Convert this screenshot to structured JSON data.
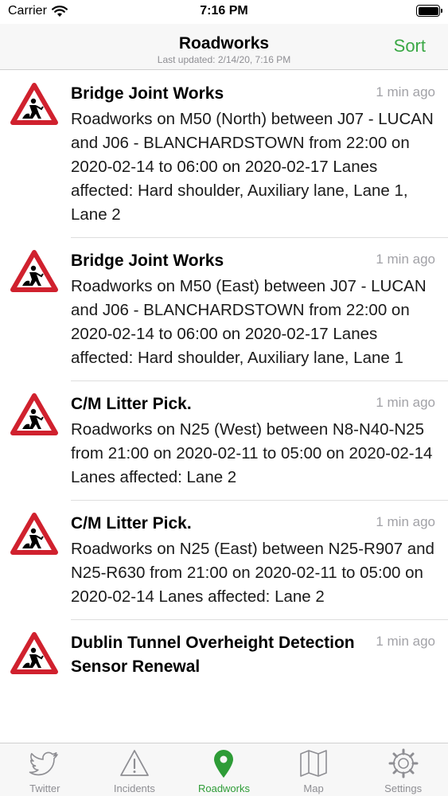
{
  "status": {
    "carrier": "Carrier",
    "time": "7:16 PM"
  },
  "nav": {
    "title": "Roadworks",
    "subtitle": "Last updated: 2/14/20, 7:16 PM",
    "sort_label": "Sort"
  },
  "colors": {
    "accent": "#3aa845",
    "warning_red": "#d0212e",
    "tab_inactive": "#8e8e93"
  },
  "items": [
    {
      "title": "Bridge Joint Works",
      "time": "1 min ago",
      "body": "Roadworks on M50 (North) between J07 - LUCAN and J06 - BLANCHARDSTOWN from 22:00 on 2020-02-14 to 06:00 on 2020-02-17 Lanes affected: Hard shoulder, Auxiliary lane, Lane 1, Lane 2",
      "icon": "roadworks-sign-icon"
    },
    {
      "title": "Bridge Joint Works",
      "time": "1 min ago",
      "body": "Roadworks on M50 (East) between J07 - LUCAN and J06 - BLANCHARDSTOWN from 22:00 on 2020-02-14 to 06:00 on 2020-02-17 Lanes affected: Hard shoulder, Auxiliary lane, Lane 1",
      "icon": "roadworks-sign-icon"
    },
    {
      "title": "C/M Litter Pick.",
      "time": "1 min ago",
      "body": "Roadworks on N25 (West) between N8-N40-N25 from 21:00 on 2020-02-11 to 05:00 on 2020-02-14 Lanes affected: Lane 2",
      "icon": "roadworks-sign-icon"
    },
    {
      "title": "C/M Litter Pick.",
      "time": "1 min ago",
      "body": "Roadworks on N25 (East) between N25-R907 and N25-R630 from 21:00 on 2020-02-11 to 05:00 on 2020-02-14 Lanes affected: Lane 2",
      "icon": "roadworks-sign-icon"
    },
    {
      "title": "Dublin Tunnel Overheight Detection Sensor Renewal",
      "time": "1 min ago",
      "body": "",
      "icon": "roadworks-sign-icon"
    }
  ],
  "tabs": [
    {
      "label": "Twitter",
      "icon": "twitter-bird-icon",
      "active": false
    },
    {
      "label": "Incidents",
      "icon": "warning-triangle-icon",
      "active": false
    },
    {
      "label": "Roadworks",
      "icon": "map-pin-icon",
      "active": true
    },
    {
      "label": "Map",
      "icon": "map-icon",
      "active": false
    },
    {
      "label": "Settings",
      "icon": "gear-icon",
      "active": false
    }
  ]
}
